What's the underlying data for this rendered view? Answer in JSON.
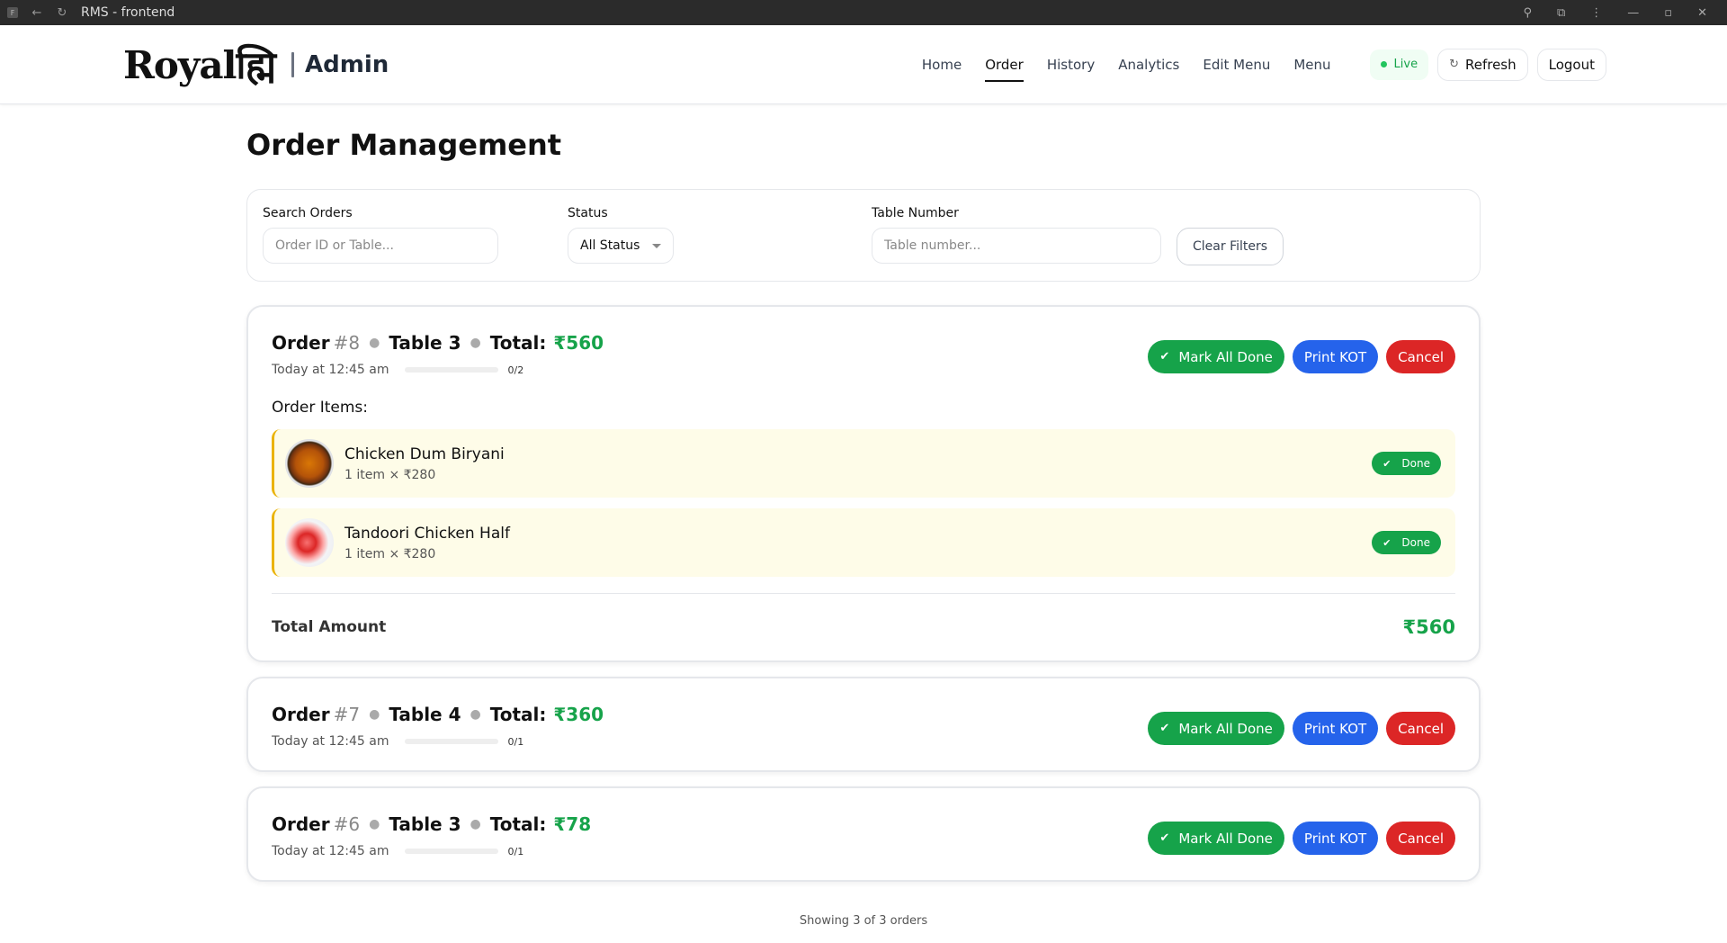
{
  "window": {
    "title": "RMS - frontend"
  },
  "header": {
    "logo_text": "Royalह्मि",
    "section": "Admin",
    "nav": [
      {
        "label": "Home",
        "active": false
      },
      {
        "label": "Order",
        "active": true
      },
      {
        "label": "History",
        "active": false
      },
      {
        "label": "Analytics",
        "active": false
      },
      {
        "label": "Edit Menu",
        "active": false
      },
      {
        "label": "Menu",
        "active": false
      }
    ],
    "live_label": "Live",
    "refresh_label": "Refresh",
    "logout_label": "Logout"
  },
  "page": {
    "title": "Order Management"
  },
  "filters": {
    "search_label": "Search Orders",
    "search_placeholder": "Order ID or Table...",
    "status_label": "Status",
    "status_value": "All Status",
    "table_label": "Table Number",
    "table_placeholder": "Table number...",
    "clear_label": "Clear Filters"
  },
  "orders": [
    {
      "order_prefix": "Order",
      "order_number": "#8",
      "table": "Table 3",
      "total_label": "Total:",
      "total": "₹560",
      "time": "Today at 12:45 am",
      "progress": "0/2",
      "progress_fraction": 0,
      "actions": {
        "mark_all_done": "Mark All Done",
        "print_kot": "Print KOT",
        "cancel": "Cancel"
      },
      "items_label": "Order Items:",
      "items": [
        {
          "name": "Chicken Dum Biryani",
          "detail": "1 item × ₹280",
          "status": "Done"
        },
        {
          "name": "Tandoori Chicken Half",
          "detail": "1 item × ₹280",
          "status": "Done"
        }
      ],
      "total_amount_label": "Total Amount",
      "total_amount": "₹560"
    },
    {
      "order_prefix": "Order",
      "order_number": "#7",
      "table": "Table 4",
      "total_label": "Total:",
      "total": "₹360",
      "time": "Today at 12:45 am",
      "progress": "0/1",
      "progress_fraction": 0,
      "actions": {
        "mark_all_done": "Mark All Done",
        "print_kot": "Print KOT",
        "cancel": "Cancel"
      }
    },
    {
      "order_prefix": "Order",
      "order_number": "#6",
      "table": "Table 3",
      "total_label": "Total:",
      "total": "₹78",
      "time": "Today at 12:45 am",
      "progress": "0/1",
      "progress_fraction": 0,
      "actions": {
        "mark_all_done": "Mark All Done",
        "print_kot": "Print KOT",
        "cancel": "Cancel"
      }
    }
  ],
  "footer": {
    "showing": "Showing 3 of 3 orders"
  },
  "colors": {
    "accent_green": "#16a34a",
    "accent_blue": "#2563eb",
    "accent_red": "#dc2626",
    "item_bg": "#fefce8",
    "item_border": "#eab308"
  }
}
